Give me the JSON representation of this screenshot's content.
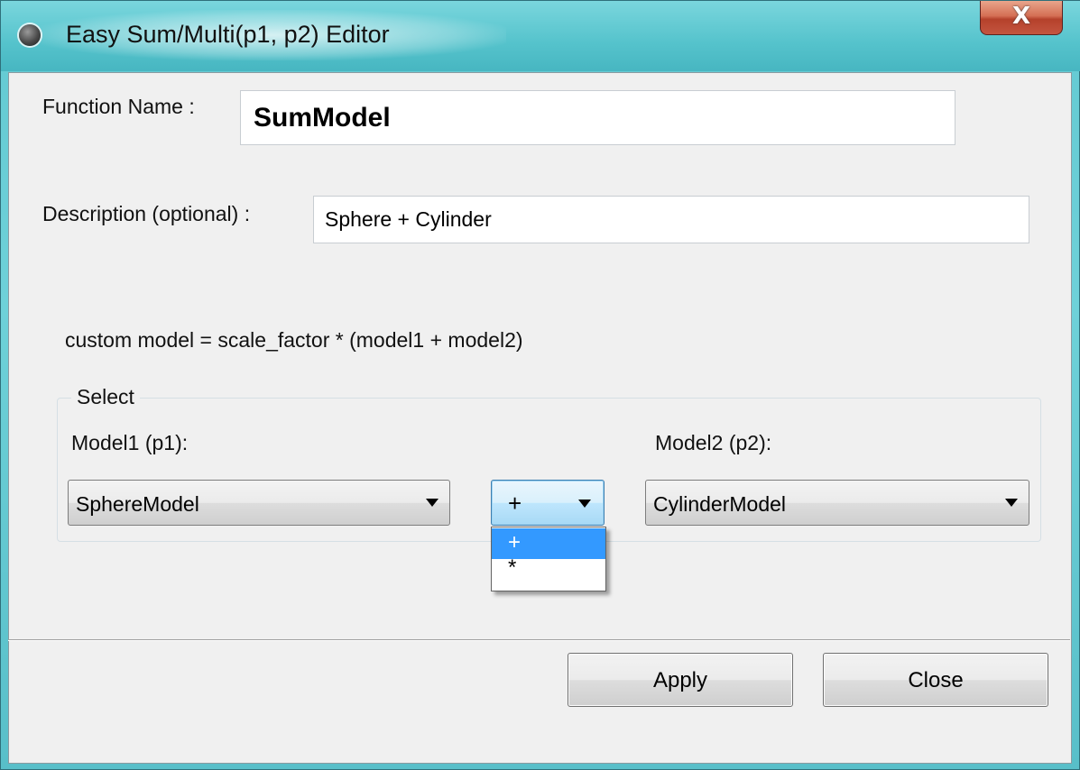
{
  "window": {
    "title": "Easy Sum/Multi(p1, p2) Editor",
    "close_symbol": "X"
  },
  "form": {
    "function_name_label": "Function Name :",
    "function_name_value": "SumModel",
    "description_label": "Description (optional) :",
    "description_value": "Sphere + Cylinder",
    "formula_text": "custom model = scale_factor * (model1 + model2)"
  },
  "select_group": {
    "title": "Select",
    "model1_label": "Model1 (p1):",
    "model1_value": "SphereModel",
    "operator_value": "+",
    "operator_options": [
      "+",
      "*"
    ],
    "operator_selected_index": 0,
    "model2_label": "Model2 (p2):",
    "model2_value": "CylinderModel"
  },
  "buttons": {
    "apply": "Apply",
    "close": "Close"
  },
  "icons": {
    "app_icon": "record-circle-icon",
    "close_icon": "close-x-icon",
    "dropdown_icon": "triangle-down-icon"
  }
}
